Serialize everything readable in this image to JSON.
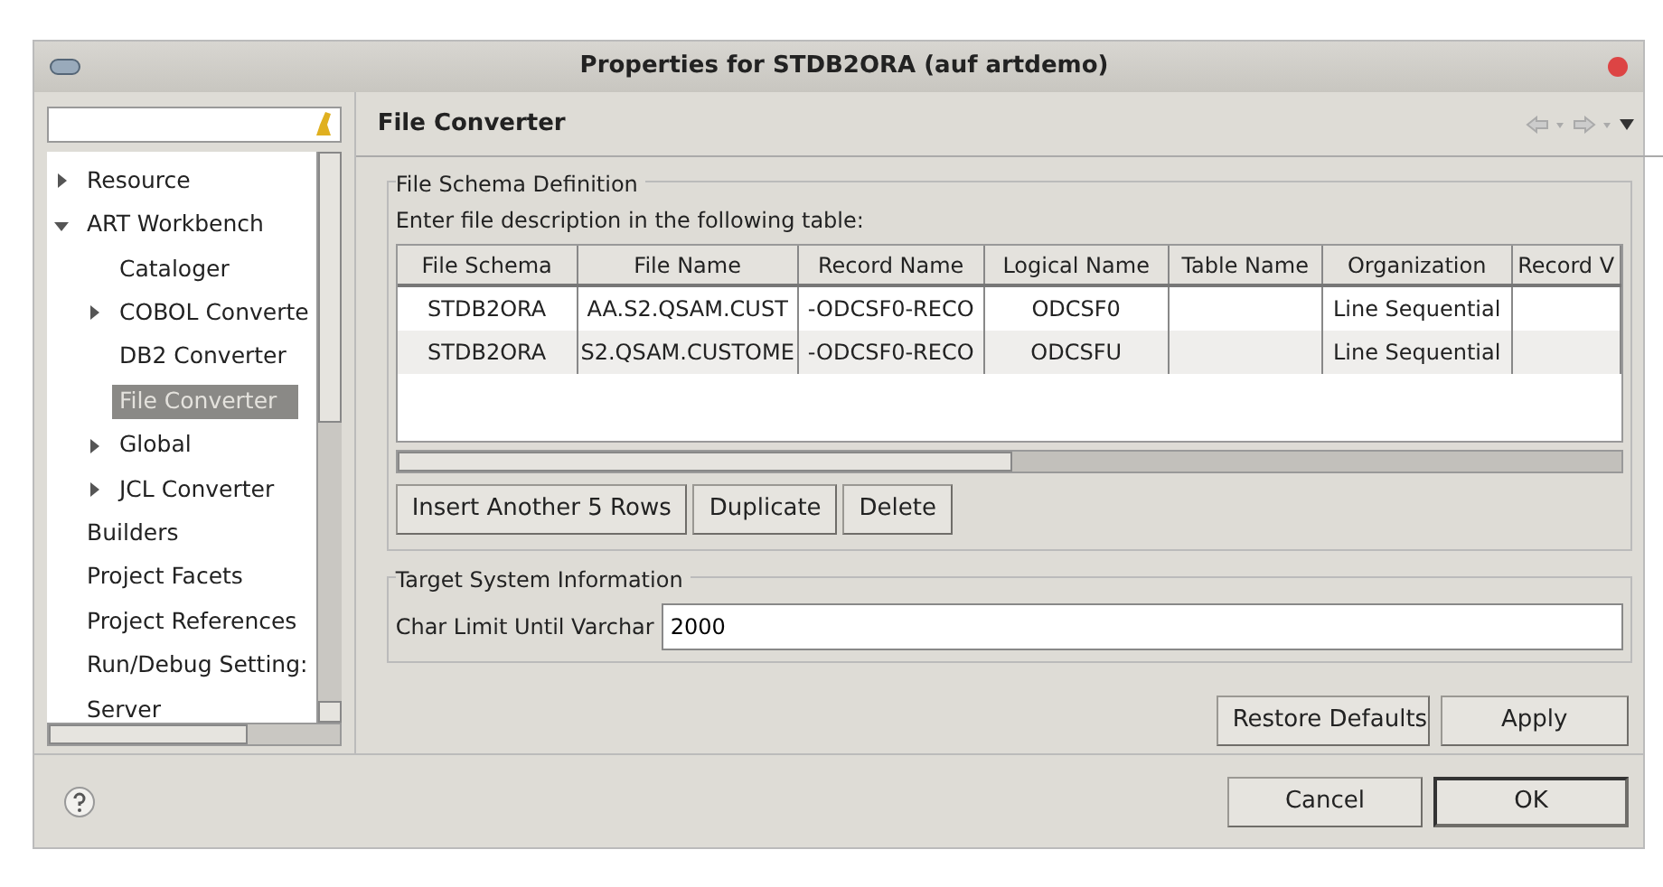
{
  "window": {
    "title": "Properties for STDB2ORA  (auf artdemo)"
  },
  "sidebar": {
    "items": [
      {
        "label": "Resource",
        "expanded": false,
        "selected": false
      },
      {
        "label": "ART Workbench",
        "expanded": true,
        "selected": false,
        "children": [
          {
            "label": "Cataloger",
            "selected": false
          },
          {
            "label": "COBOL Converte",
            "expanded": false,
            "selected": false
          },
          {
            "label": "DB2 Converter",
            "selected": false
          },
          {
            "label": "File Converter",
            "selected": true
          },
          {
            "label": "Global",
            "expanded": false,
            "selected": false
          },
          {
            "label": "JCL Converter",
            "expanded": false,
            "selected": false
          }
        ]
      },
      {
        "label": "Builders",
        "selected": false
      },
      {
        "label": "Project Facets",
        "selected": false
      },
      {
        "label": "Project References",
        "selected": false
      },
      {
        "label": "Run/Debug Setting:",
        "selected": false
      },
      {
        "label": "Server",
        "selected": false
      }
    ]
  },
  "page": {
    "title": "File Converter"
  },
  "schema_group": {
    "title": "File Schema Definition",
    "hint": "Enter file description in the following table:",
    "table": {
      "columns": [
        "File Schema",
        "File Name",
        "Record Name",
        "Logical Name",
        "Table Name",
        "Organization",
        "Record V"
      ],
      "rows": [
        [
          "STDB2ORA",
          "AA.S2.QSAM.CUST",
          "-ODCSF0-RECO",
          "ODCSF0",
          null,
          "Line Sequential",
          null
        ],
        [
          "STDB2ORA",
          "S2.QSAM.CUSTOME",
          "-ODCSF0-RECO",
          "ODCSFU",
          null,
          "Line Sequential",
          null
        ]
      ]
    },
    "buttons": [
      "Insert Another 5 Rows",
      "Duplicate",
      "Delete"
    ]
  },
  "target_group": {
    "title": "Target System Information",
    "field": {
      "label": "Char Limit Until Varchar",
      "value": "2000"
    }
  },
  "page_buttons": [
    "Restore Defaults",
    "Apply"
  ],
  "dialog_buttons": [
    "Cancel",
    "OK"
  ]
}
